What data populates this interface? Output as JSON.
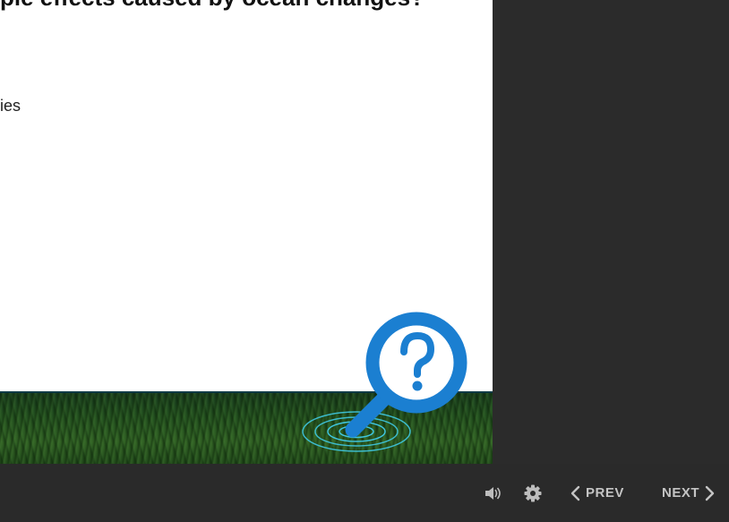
{
  "slide": {
    "title": "ple effects caused by ocean changes?",
    "body_text": "ies"
  },
  "controls": {
    "prev_label": "PREV",
    "next_label": "NEXT",
    "volume_icon": "volume-icon",
    "settings_icon": "gear-icon"
  },
  "colors": {
    "background": "#2a2a2a",
    "slide": "#ffffff",
    "accent_blue": "#1b7fd1",
    "ripple_cyan": "#3fc6e0",
    "control_text": "#c4c4c4"
  }
}
